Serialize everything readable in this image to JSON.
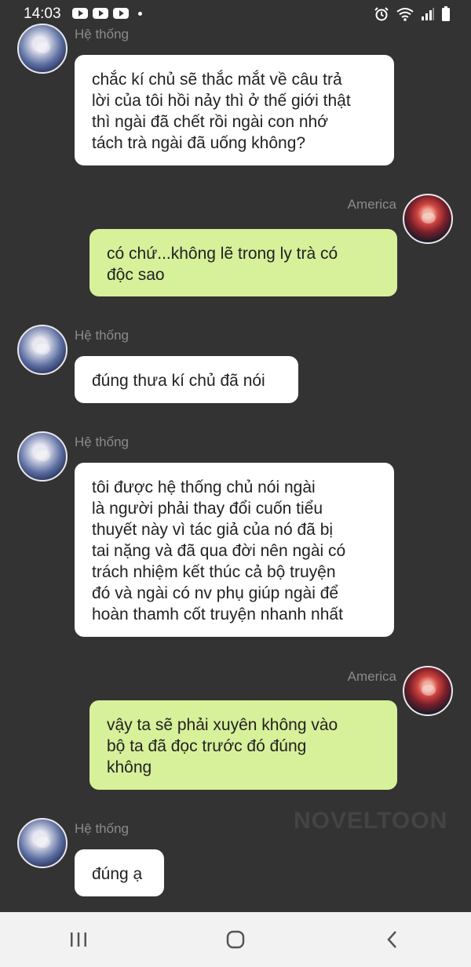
{
  "status_bar": {
    "time": "14:03"
  },
  "messages": [
    {
      "sender": "Hệ thống",
      "role": "system",
      "text": "chắc kí chủ sẽ thắc mắt về câu trả\nlời của tôi hồi nảy thì ở thế giới thật\nthì ngài đã chết rồi ngài con nhớ\ntách trà ngài đã uống không?"
    },
    {
      "sender": "America",
      "role": "user",
      "text": "có chứ...không lẽ trong ly trà có\nđộc sao"
    },
    {
      "sender": "Hệ thống",
      "role": "system",
      "text": "đúng thưa kí chủ đã nói"
    },
    {
      "sender": "Hệ thống",
      "role": "system",
      "text": "tôi được hệ thống chủ nói ngài\nlà người phải thay đổi cuốn tiểu\nthuyết này vì tác giả của nó đã bị\ntai nặng và đã qua đời nên ngài có\ntrách nhiệm kết thúc cả bộ truyện\nđó và ngài có nv phụ giúp ngài để\nhoàn thamh cốt truyện nhanh nhất"
    },
    {
      "sender": "America",
      "role": "user",
      "text": "vậy ta sẽ phải xuyên không vào\nbộ ta đã đọc trước đó đúng\nkhông"
    },
    {
      "sender": "Hệ thống",
      "role": "system",
      "text": "đúng ạ"
    }
  ],
  "watermark": "NOVELTOON",
  "colors": {
    "background": "#333333",
    "system_bubble": "#ffffff",
    "user_bubble": "#d7f09a",
    "sender_name": "#8b8b8b",
    "navbar": "#f2f2f2"
  },
  "icons": {
    "status_left": [
      "youtube-icon",
      "youtube-icon",
      "youtube-icon",
      "notification-dot-icon"
    ],
    "status_right": [
      "alarm-icon",
      "wifi-icon",
      "signal-icon",
      "battery-icon"
    ],
    "navbar": [
      "recent-apps-icon",
      "home-icon",
      "back-icon"
    ]
  }
}
